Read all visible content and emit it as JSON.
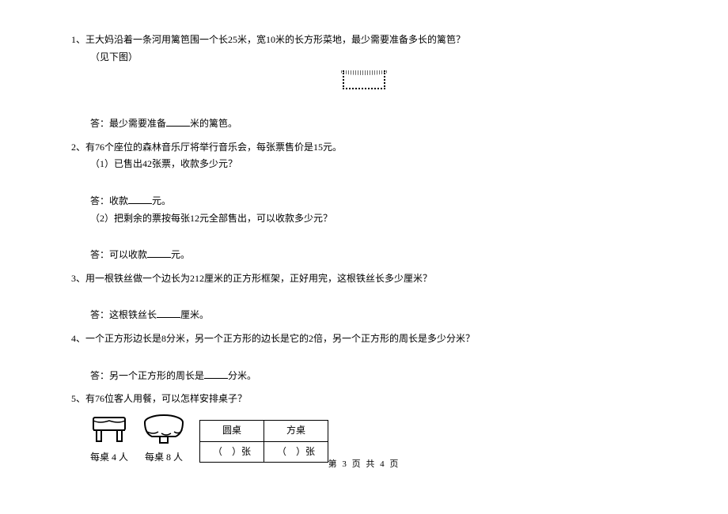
{
  "q1": {
    "num": "1、",
    "text": "王大妈沿着一条河用篱笆围一个长25米，宽10米的长方形菜地，最少需要准备多长的篱笆？",
    "sub": "（见下图）",
    "answer_prefix": "答：最少需要准备",
    "answer_suffix": "米的篱笆。"
  },
  "q2": {
    "num": "2、",
    "text": "有76个座位的森林音乐厅将举行音乐会，每张票售价是15元。",
    "part1": "（1）已售出42张票，收款多少元？",
    "ans1_prefix": "答：收款",
    "ans1_suffix": "元。",
    "part2": "（2）把剩余的票按每张12元全部售出，可以收款多少元？",
    "ans2_prefix": "答：可以收款",
    "ans2_suffix": "元。"
  },
  "q3": {
    "num": "3、",
    "text": "用一根铁丝做一个边长为212厘米的正方形框架，正好用完，这根铁丝长多少厘米？",
    "answer_prefix": "答：这根铁丝长",
    "answer_suffix": "厘米。"
  },
  "q4": {
    "num": "4、",
    "text": "一个正方形边长是8分米，另一个正方形的边长是它的2倍，另一个正方形的周长是多少分米？",
    "answer_prefix": "答：另一个正方形的周长是",
    "answer_suffix": "分米。"
  },
  "q5": {
    "num": "5、",
    "text": "有76位客人用餐，可以怎样安排桌子？",
    "square_caption": "每桌 4 人",
    "round_caption": "每桌 8 人",
    "table_header_round": "圆桌",
    "table_header_square": "方桌",
    "cell_left_open": "（",
    "cell_left_close": "）张",
    "cell_right_open": "（",
    "cell_right_close": "）张"
  },
  "footer": "第 3 页 共 4 页"
}
